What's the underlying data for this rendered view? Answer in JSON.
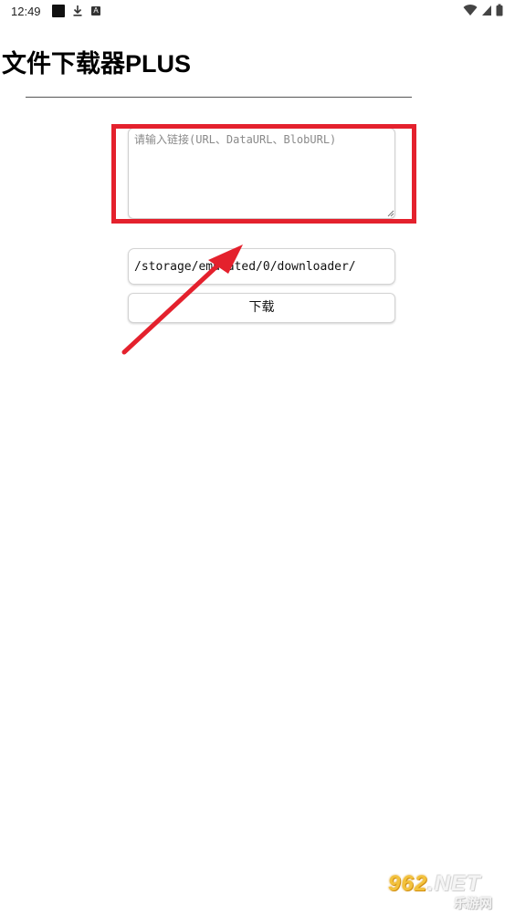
{
  "status_bar": {
    "time": "12:49",
    "notification_icons": [
      "stop-square-icon",
      "download-icon",
      "a-box-icon"
    ],
    "system_icons": [
      "wifi-icon",
      "cellular-signal-icon",
      "battery-icon"
    ]
  },
  "app": {
    "title": "文件下载器PLUS"
  },
  "form": {
    "link_input": {
      "value": "",
      "placeholder": "请输入链接(URL、DataURL、BlobURL)"
    },
    "path_input": {
      "value": "/storage/emulated/0/downloader/"
    },
    "download_button_label": "下载"
  },
  "annotation": {
    "highlight_color": "#e4212d",
    "arrow_color": "#e4212d"
  },
  "watermark": {
    "logo_prefix": "962",
    "logo_suffix": ".NET",
    "subtitle": "乐游网"
  }
}
